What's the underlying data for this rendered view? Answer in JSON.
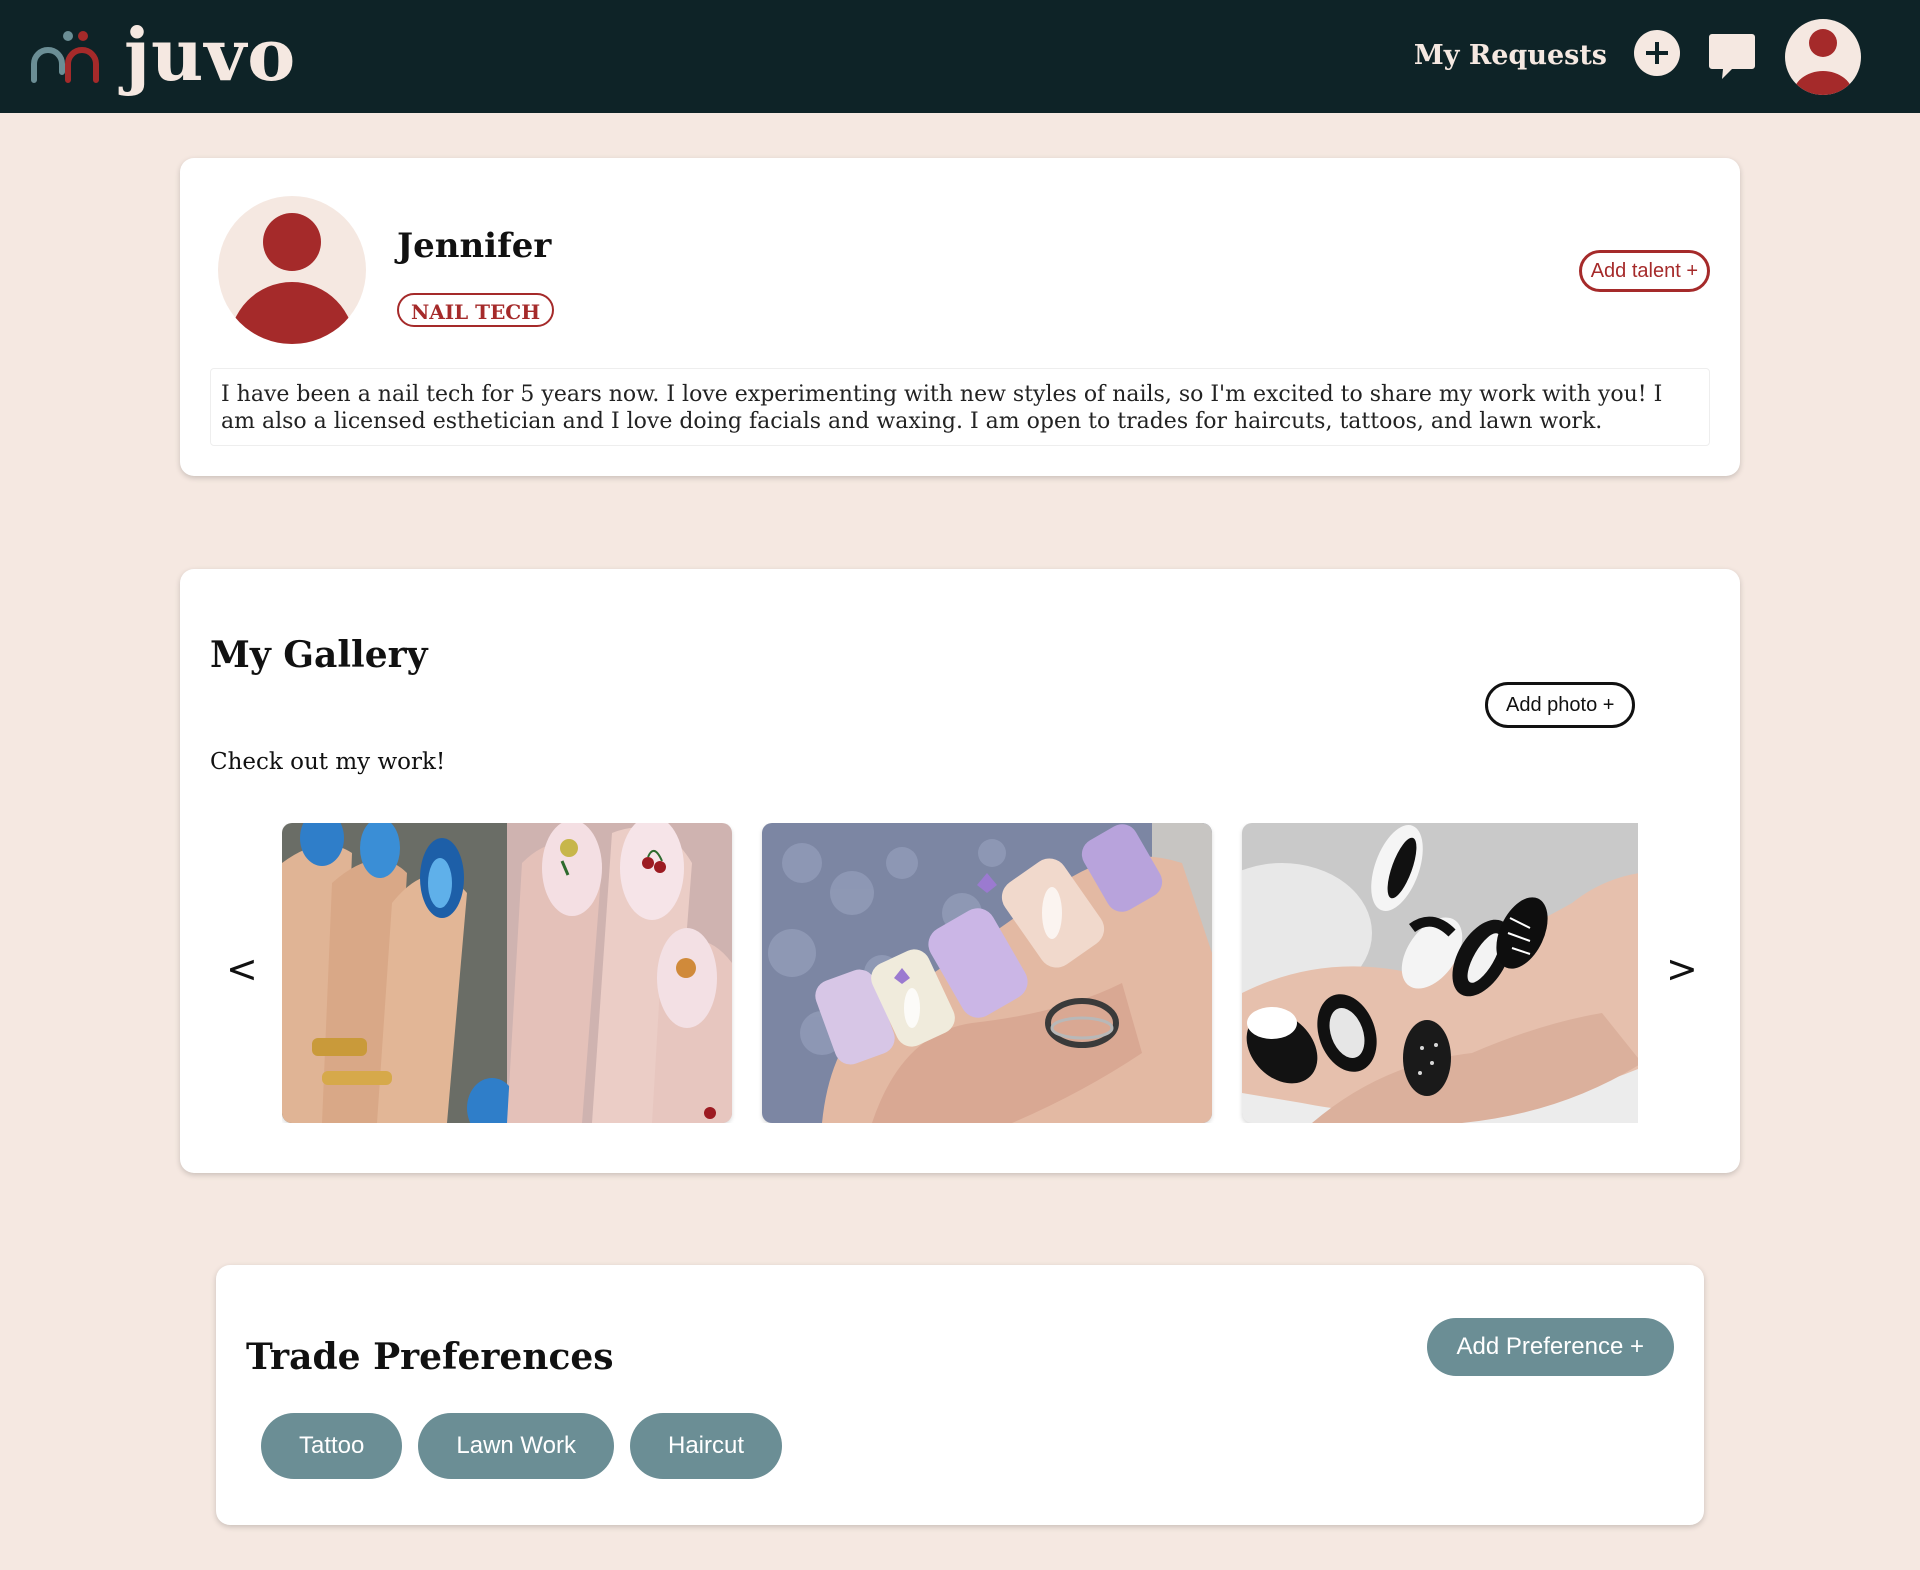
{
  "header": {
    "brand": "juvo",
    "nav_requests": "My Requests",
    "icons": {
      "logo": "juvo-logo-icon",
      "add": "plus-icon",
      "messages": "chat-icon",
      "profile": "user-avatar-icon"
    },
    "colors": {
      "background": "#0e2327",
      "accent": "#a52a2a",
      "logo_teal": "#6b8e95"
    }
  },
  "profile": {
    "name": "Jennifer",
    "talent": "NAIL TECH",
    "add_talent_label": "Add talent +",
    "bio": "I have been a nail tech for 5 years now. I love experimenting with new styles of nails, so I'm excited to share my work with you! I am also a licensed esthetician and I love doing facials and waxing. I am open to trades for haircuts, tattoos, and lawn work."
  },
  "gallery": {
    "title": "My Gallery",
    "add_photo_label": "Add photo +",
    "subtitle": "Check out my work!",
    "prev_label": "<",
    "next_label": ">",
    "photos": [
      {
        "name": "gallery-photo-blue-and-fruit-nails"
      },
      {
        "name": "gallery-photo-lavender-glitter-nails"
      },
      {
        "name": "gallery-photo-black-white-nails"
      }
    ]
  },
  "trade_preferences": {
    "title": "Trade Preferences",
    "add_label": "Add Preference +",
    "items": [
      "Tattoo",
      "Lawn Work",
      "Haircut"
    ]
  },
  "page": {
    "background": "#f5e8e1",
    "chip_color": "#6b8e95"
  }
}
